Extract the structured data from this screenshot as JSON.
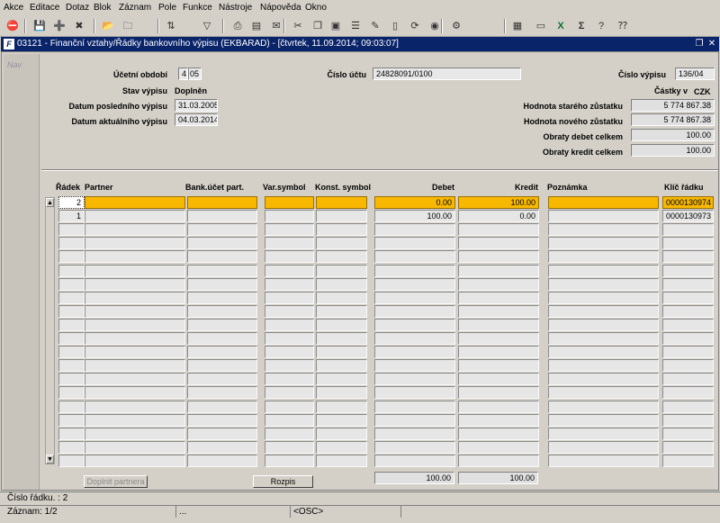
{
  "menu": [
    "Akce",
    "Editace",
    "Dotaz",
    "Blok",
    "Záznam",
    "Pole",
    "Funkce",
    "Nástroje",
    "Nápověda",
    "Okno"
  ],
  "toolbar_icons": [
    "exit-icon",
    "save-icon",
    "add-record-icon",
    "delete-record-icon",
    "folder-key-icon",
    "folder-delete-icon",
    "sort-icon",
    "filter-icon",
    "print-icon",
    "print-preview-icon",
    "mail-icon",
    "cut-icon",
    "copy-icon",
    "paste-icon",
    "list-icon",
    "edit-icon",
    "doc-icon",
    "refresh-icon",
    "globe-icon",
    "settings-icon",
    "report-icon",
    "document-icon",
    "excel-icon",
    "sum-icon",
    "help-icon",
    "help-arrow-icon"
  ],
  "window": {
    "title": "03121 - Finanční vztahy/Řádky bankovního výpisu (EKBARAD) - [čtvrtek, 11.09.2014; 09:03:07]"
  },
  "nav": {
    "label": "Nav"
  },
  "header": {
    "ucetni_obdobi_label": "Účetní období",
    "ucetni_obdobi_m": "4",
    "ucetni_obdobi_y": "05",
    "cislo_uctu_label": "Číslo účtu",
    "cislo_uctu": "24828091/0100",
    "cislo_vypisu_label": "Číslo výpisu",
    "cislo_vypisu": "136/04",
    "stav_label": "Stav výpisu",
    "stav": "Doplněn",
    "castky_label": "Částky v",
    "mena": "CZK",
    "datum_posl_label": "Datum posledního výpisu",
    "datum_posl": "31.03.2005",
    "datum_akt_label": "Datum aktuálního výpisu",
    "datum_akt": "04.03.2014",
    "hodnota_stary_label": "Hodnota starého zůstatku",
    "hodnota_stary": "5 774 867.38",
    "hodnota_novy_label": "Hodnota nového zůstatku",
    "hodnota_novy": "5 774 867.38",
    "debet_celkem_label": "Obraty debet celkem",
    "debet_celkem": "100.00",
    "kredit_celkem_label": "Obraty kredit celkem",
    "kredit_celkem": "100.00"
  },
  "table": {
    "columns": [
      "Řádek",
      "Partner",
      "Bank.účet part.",
      "Var.symbol",
      "Konst. symbol",
      "Debet",
      "Kredit",
      "Poznámka",
      "Klíč řádku"
    ],
    "rows": [
      {
        "radek": "2",
        "partner": "",
        "bank": "",
        "var": "",
        "konst": "",
        "debet": "0.00",
        "kredit": "100.00",
        "pozn": "",
        "klic": "0000130974"
      },
      {
        "radek": "1",
        "partner": "",
        "bank": "",
        "var": "",
        "konst": "",
        "debet": "100.00",
        "kredit": "0.00",
        "pozn": "",
        "klic": "0000130973"
      }
    ],
    "sum_debet": "100.00",
    "sum_kredit": "100.00"
  },
  "buttons": {
    "doplnit": "Doplnit partnera",
    "rozpis": "Rozpis"
  },
  "status": {
    "line1": "Číslo řádku. : 2",
    "line2_a": "Záznam: 1/2",
    "line2_b": "...",
    "line2_c": "<OSC>"
  }
}
